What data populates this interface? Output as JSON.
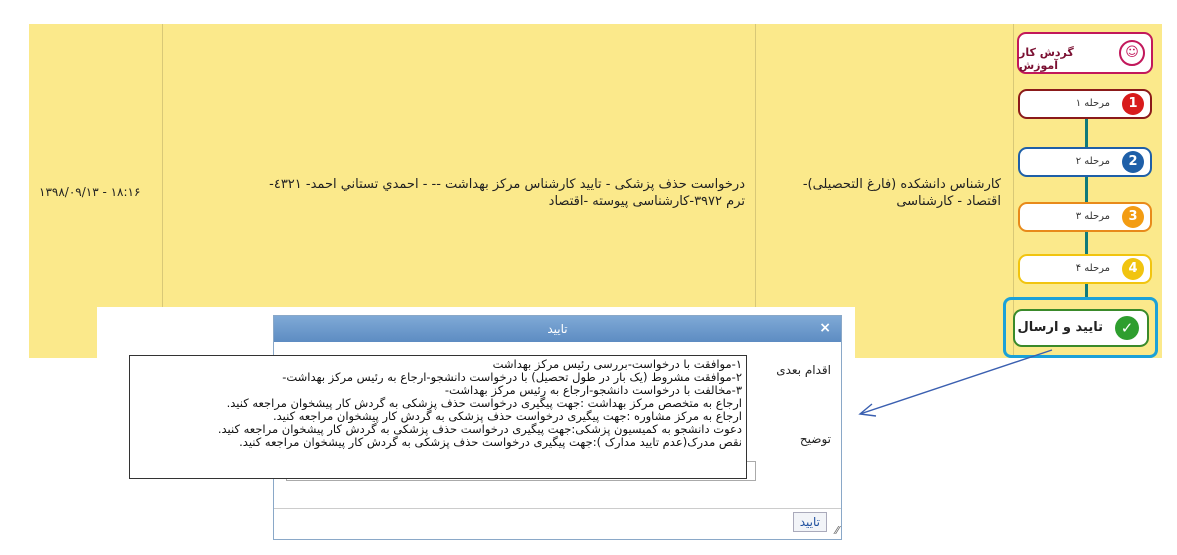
{
  "row": {
    "date": "۱۳۹۸/۰۹/۱۳ - ۱۸:۱۶",
    "description_lines": [
      "درخواست حذف پزشکی - تایید کارشناس مرکز بهداشت -- - احمدي تستاني احمد- ٤٣٢١-",
      "ترم ۳۹۷۲-کارشناسی پیوسته -اقتصاد"
    ],
    "role_lines": [
      "کارشناس دانشکده (فارغ التحصیلی)-",
      "اقتصاد - کارشناسی"
    ]
  },
  "workflow": {
    "brand_label": "گردش کار آموزش",
    "steps": [
      {
        "label": "مرحله ۱",
        "number": "1"
      },
      {
        "label": "مرحله ۲",
        "number": "2"
      },
      {
        "label": "مرحله ۳",
        "number": "3"
      },
      {
        "label": "مرحله ۴",
        "number": "4"
      }
    ],
    "confirm_label": "تایید و ارسال"
  },
  "dialog": {
    "title": "تایید",
    "close": "×",
    "next_action_label": "اقدام بعدی",
    "description_label": "توضیح",
    "confirm_button": "تایید"
  },
  "notes": [
    "۱-موافقت با درخواست-بررسی رئیس مرکز بهداشت",
    "۲-موافقت مشروط (یک بار در طول تحصیل) با درخواست دانشجو-ارجاع به رئیس مرکز بهداشت-",
    "۳-مخالفت با درخواست دانشجو-ارجاع به رئیس مرکز بهداشت-",
    "ارجاع به متخصص مرکز بهداشت :جهت پیگیری درخواست حذف پزشکی به گردش کار پیشخوان مراجعه کنید.",
    "ارجاع به مرکز مشاوره :جهت پیگیری درخواست حذف پزشکی به گردش کار پیشخوان مراجعه کنید.",
    "دعوت دانشجو به کمیسیون پزشکی:جهت پیگیری درخواست حذف پزشکی به گردش کار پیشخوان مراجعه کنید.",
    "نقص مدرک(عدم تایید مدارک ):جهت پیگیری درخواست حذف پزشکی به گردش کار پیشخوان مراجعه کنید."
  ]
}
